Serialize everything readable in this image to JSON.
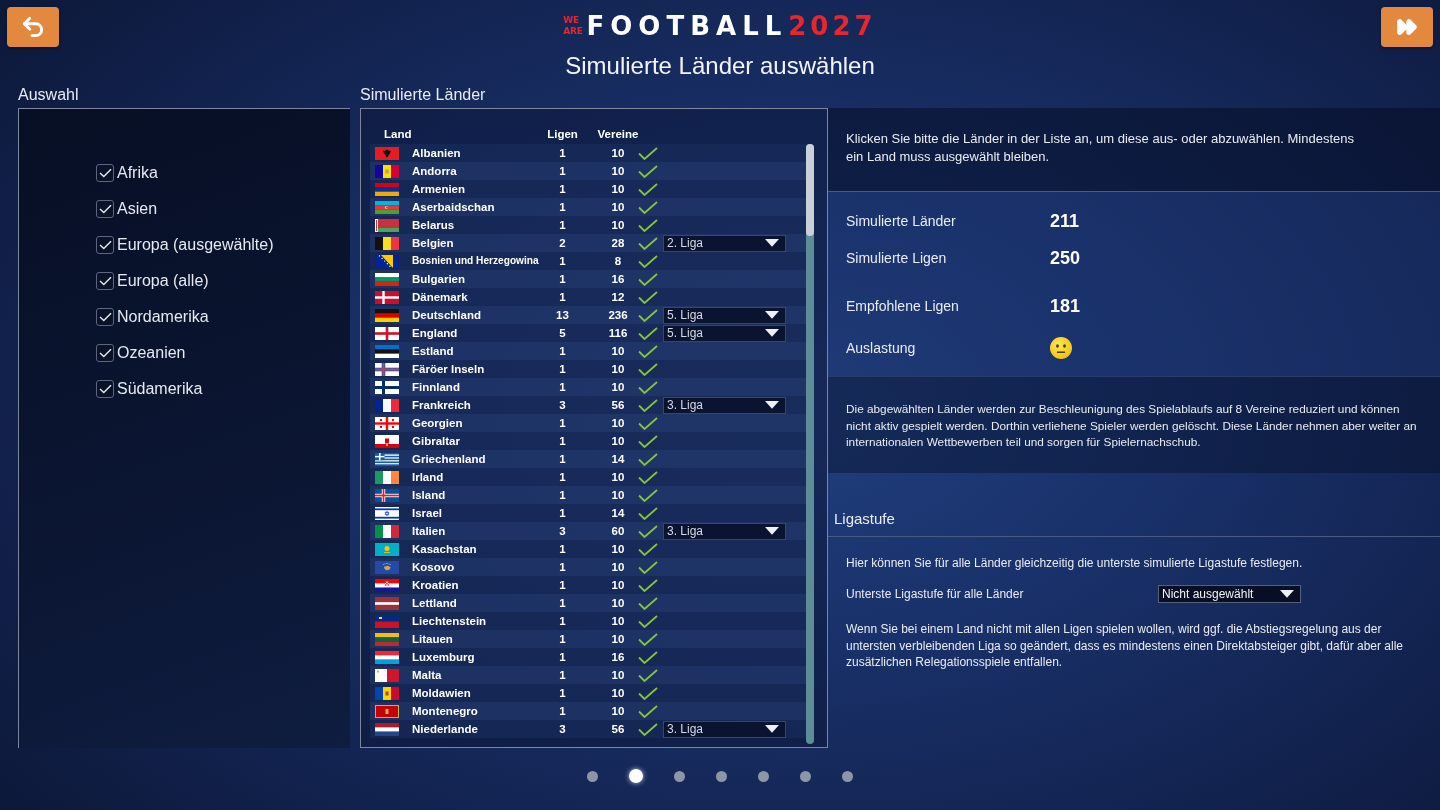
{
  "header": {
    "logo": {
      "top": "WE",
      "bottom": "ARE",
      "name": "FOOTBALL",
      "year": "2027"
    },
    "title": "Simulierte Länder auswählen"
  },
  "selection": {
    "label": "Auswahl",
    "regions": [
      {
        "label": "Afrika",
        "checked": true
      },
      {
        "label": "Asien",
        "checked": true
      },
      {
        "label": "Europa (ausgewählte)",
        "checked": true
      },
      {
        "label": "Europa (alle)",
        "checked": true
      },
      {
        "label": "Nordamerika",
        "checked": true
      },
      {
        "label": "Ozeanien",
        "checked": true
      },
      {
        "label": "Südamerika",
        "checked": true
      }
    ]
  },
  "countries": {
    "label": "Simulierte Länder",
    "columns": [
      "Land",
      "Ligen",
      "Vereine"
    ],
    "rows": [
      {
        "land": "Albanien",
        "ligen": "1",
        "vereine": "10",
        "selected": true
      },
      {
        "land": "Andorra",
        "ligen": "1",
        "vereine": "10",
        "selected": true
      },
      {
        "land": "Armenien",
        "ligen": "1",
        "vereine": "10",
        "selected": true
      },
      {
        "land": "Aserbaidschan",
        "ligen": "1",
        "vereine": "10",
        "selected": true
      },
      {
        "land": "Belarus",
        "ligen": "1",
        "vereine": "10",
        "selected": true
      },
      {
        "land": "Belgien",
        "ligen": "2",
        "vereine": "28",
        "selected": true,
        "liga": "2. Liga"
      },
      {
        "land": "Bosnien und Herzegowina",
        "ligen": "1",
        "vereine": "8",
        "selected": true
      },
      {
        "land": "Bulgarien",
        "ligen": "1",
        "vereine": "16",
        "selected": true
      },
      {
        "land": "Dänemark",
        "ligen": "1",
        "vereine": "12",
        "selected": true
      },
      {
        "land": "Deutschland",
        "ligen": "13",
        "vereine": "236",
        "selected": true,
        "liga": "5. Liga"
      },
      {
        "land": "England",
        "ligen": "5",
        "vereine": "116",
        "selected": true,
        "liga": "5. Liga"
      },
      {
        "land": "Estland",
        "ligen": "1",
        "vereine": "10",
        "selected": true
      },
      {
        "land": "Färöer Inseln",
        "ligen": "1",
        "vereine": "10",
        "selected": true
      },
      {
        "land": "Finnland",
        "ligen": "1",
        "vereine": "10",
        "selected": true
      },
      {
        "land": "Frankreich",
        "ligen": "3",
        "vereine": "56",
        "selected": true,
        "liga": "3. Liga"
      },
      {
        "land": "Georgien",
        "ligen": "1",
        "vereine": "10",
        "selected": true
      },
      {
        "land": "Gibraltar",
        "ligen": "1",
        "vereine": "10",
        "selected": true
      },
      {
        "land": "Griechenland",
        "ligen": "1",
        "vereine": "14",
        "selected": true
      },
      {
        "land": "Irland",
        "ligen": "1",
        "vereine": "10",
        "selected": true
      },
      {
        "land": "Island",
        "ligen": "1",
        "vereine": "10",
        "selected": true
      },
      {
        "land": "Israel",
        "ligen": "1",
        "vereine": "14",
        "selected": true
      },
      {
        "land": "Italien",
        "ligen": "3",
        "vereine": "60",
        "selected": true,
        "liga": "3. Liga"
      },
      {
        "land": "Kasachstan",
        "ligen": "1",
        "vereine": "10",
        "selected": true
      },
      {
        "land": "Kosovo",
        "ligen": "1",
        "vereine": "10",
        "selected": true
      },
      {
        "land": "Kroatien",
        "ligen": "1",
        "vereine": "10",
        "selected": true
      },
      {
        "land": "Lettland",
        "ligen": "1",
        "vereine": "10",
        "selected": true
      },
      {
        "land": "Liechtenstein",
        "ligen": "1",
        "vereine": "10",
        "selected": true
      },
      {
        "land": "Litauen",
        "ligen": "1",
        "vereine": "10",
        "selected": true
      },
      {
        "land": "Luxemburg",
        "ligen": "1",
        "vereine": "16",
        "selected": true
      },
      {
        "land": "Malta",
        "ligen": "1",
        "vereine": "10",
        "selected": true
      },
      {
        "land": "Moldawien",
        "ligen": "1",
        "vereine": "10",
        "selected": true
      },
      {
        "land": "Montenegro",
        "ligen": "1",
        "vereine": "10",
        "selected": true
      },
      {
        "land": "Niederlande",
        "ligen": "3",
        "vereine": "56",
        "selected": true,
        "liga": "3. Liga"
      }
    ]
  },
  "info": {
    "instructions": "Klicken Sie bitte die Länder in der Liste an, um diese aus- oder abzuwählen. Mindestens ein Land muss ausgewählt bleiben.",
    "stats": [
      {
        "label": "Simulierte Länder",
        "kind": "number",
        "value": "211"
      },
      {
        "label": "Simulierte Ligen",
        "kind": "number",
        "value": "250"
      },
      {
        "label": "Empfohlene Ligen",
        "kind": "number",
        "value": "181"
      },
      {
        "label": "Auslastung",
        "kind": "mood"
      }
    ],
    "note": "Die abgewählten Länder werden zur Beschleunigung des Spielablaufs auf 8 Vereine reduziert und können nicht aktiv gespielt werden. Dorthin verliehene Spieler werden gelöscht. Diese Länder nehmen aber weiter an internationalen Wettbewerben teil und sorgen für Spielernachschub."
  },
  "league_level": {
    "title": "Ligastufe",
    "intro": "Hier können Sie für alle Länder gleichzeitig die unterste simulierte Ligastufe festlegen.",
    "field_label": "Unterste Ligastufe für alle Länder",
    "field_value": "Nicht ausgewählt",
    "note": "Wenn Sie bei einem Land nicht mit allen Ligen spielen wollen, wird ggf. die Abstiegsregelung aus der untersten verbleibenden Liga so geändert, dass es mindestens einen Direktabsteiger gibt, dafür aber alle zusätzlichen Relegationsspiele entfallen."
  },
  "pages": [
    {
      "selected": false
    },
    {
      "selected": true
    },
    {
      "selected": false
    },
    {
      "selected": false
    },
    {
      "selected": false
    },
    {
      "selected": false
    },
    {
      "selected": false
    }
  ]
}
